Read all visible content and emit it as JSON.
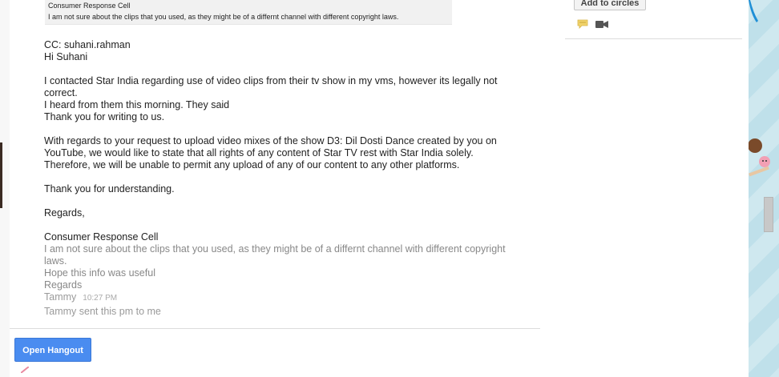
{
  "quote": {
    "line1": "Consumer Response Cell",
    "line2": "I am not sure about the clips that you used, as they might be of a differnt channel with different copyright laws."
  },
  "message": {
    "cc": "CC: suhani.rahman",
    "greeting": "Hi Suhani",
    "p1a": "I contacted Star India regarding use of video clips from their tv show in my vms, however its legally not",
    "p1b": "correct.",
    "p1c": "I heard from them this morning. They said",
    "p1d": "Thank you for writing to us.",
    "p2a": "With regards to your request to upload video mixes of the show D3: Dil Dosti Dance created by you on",
    "p2b": "YouTube, we would like to state that all rights of any content of Star TV rest with Star India solely.",
    "p2c": "Therefore, we will be unable to permit any upload of any of our content to any other platforms.",
    "thanks": "Thank you for understanding.",
    "regards": "Regards,",
    "signature": "Consumer Response Cell",
    "reply_a": "I am not sure about the clips that you used, as they might be of a differnt channel with different copyright",
    "reply_b": "laws.",
    "reply_c": "Hope this info was useful",
    "reply_d": "Regards",
    "sender": "Tammy",
    "time": "10:27 PM",
    "last": "Tammy sent this pm to me"
  },
  "buttons": {
    "open_hangout": "Open Hangout",
    "add_to_circles": "Add to circles"
  },
  "icons": {
    "chat": "chat-bubble-icon",
    "video": "video-camera-icon"
  },
  "colors": {
    "hangout_button": "#4a8cf0",
    "chat_icon": "#f1d36a",
    "background_stripe": "#cfe8ef"
  }
}
